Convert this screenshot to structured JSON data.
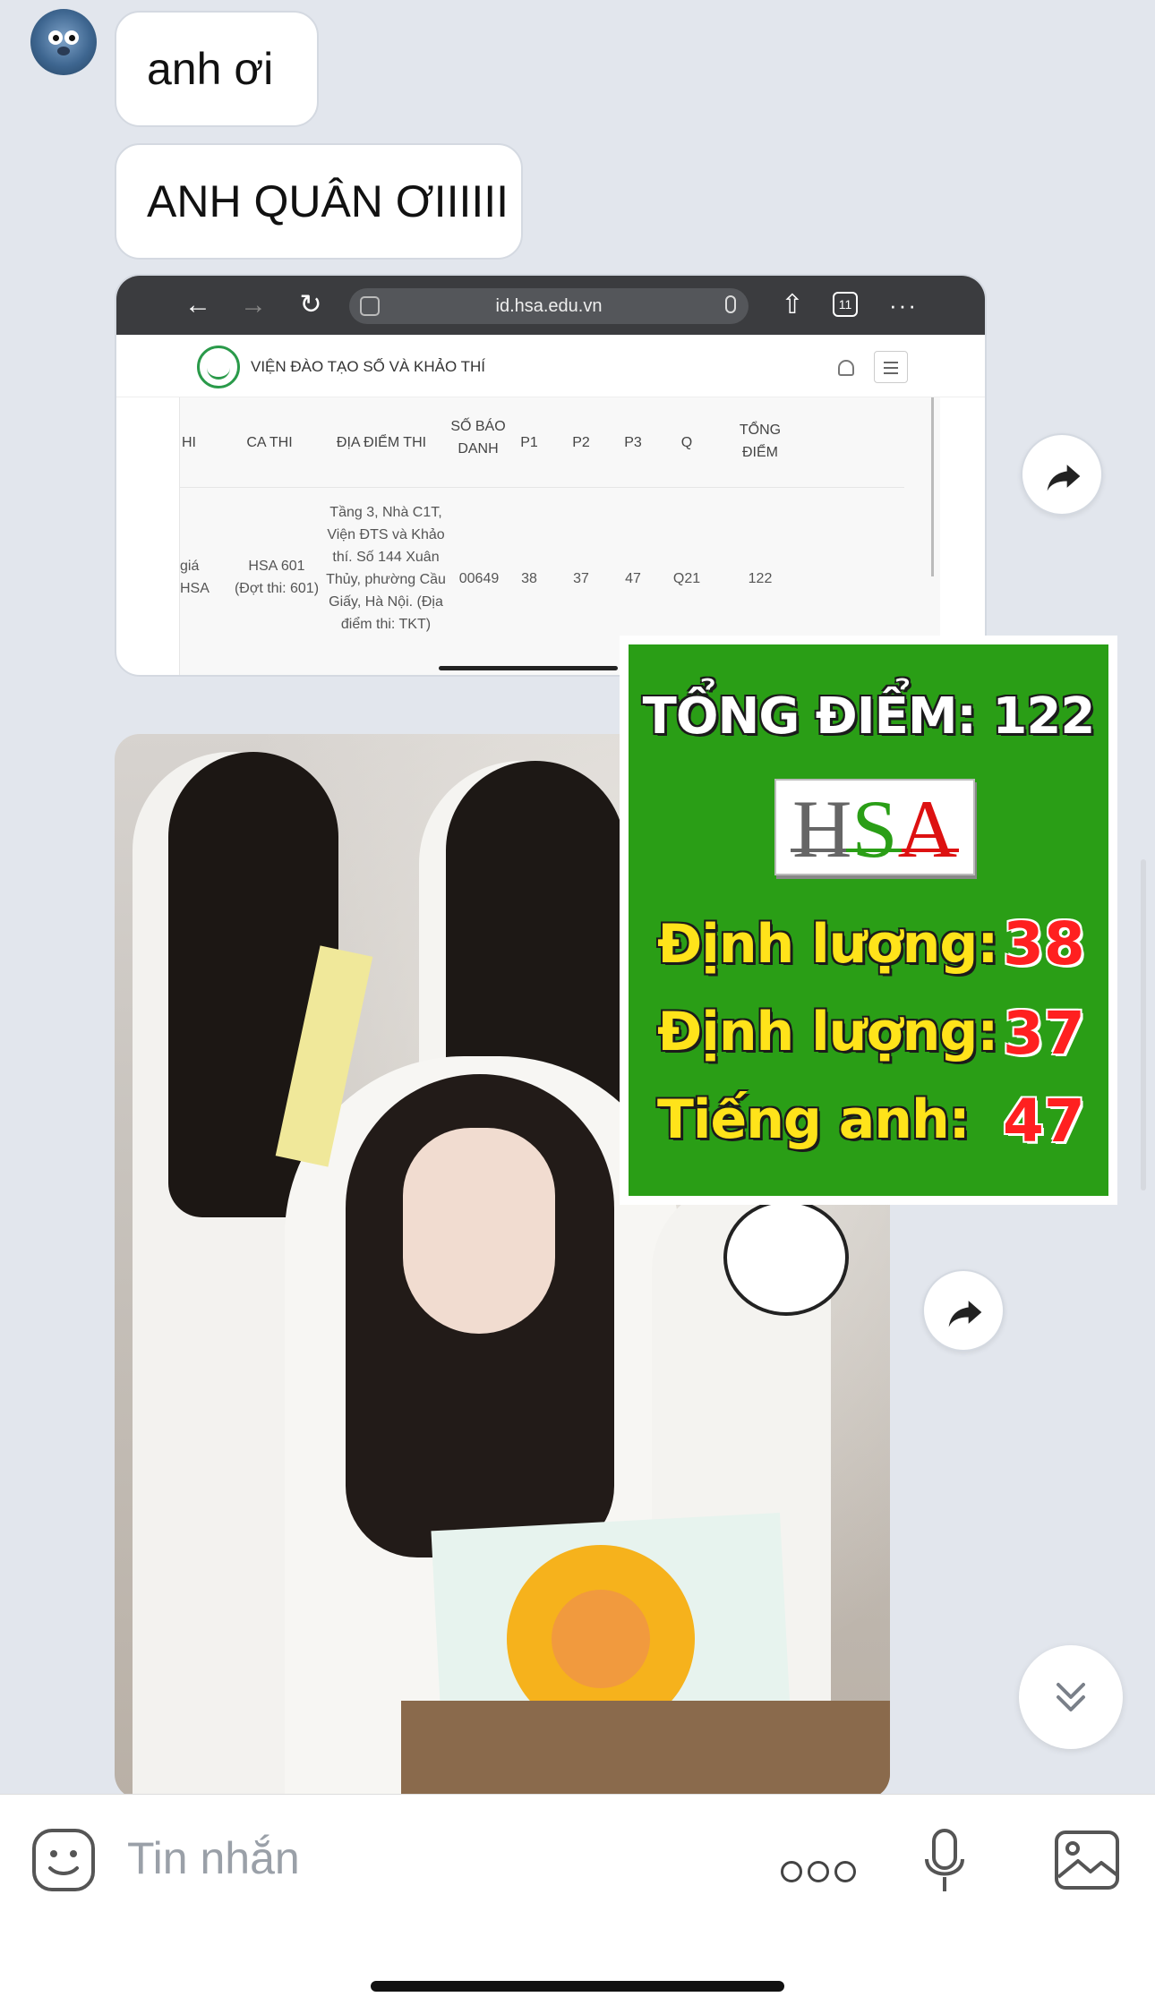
{
  "messages": [
    {
      "text": "anh ơi"
    },
    {
      "text": "ANH QUÂN ƠIIIIII"
    }
  ],
  "browser": {
    "url": "id.hsa.edu.vn",
    "tab_count": "11",
    "site_title": "VIỆN ĐÀO TẠO SỐ VÀ KHẢO THÍ",
    "headers": [
      "HI",
      "CA THI",
      "ĐỊA ĐIỂM THI",
      "SỐ BÁO DANH",
      "P1",
      "P2",
      "P3",
      "Q",
      "TỔNG ĐIỂM"
    ],
    "row": {
      "col0": "giá HSA",
      "ca_thi": "HSA 601 (Đợt thi: 601)",
      "dia_diem": "Tầng 3, Nhà C1T, Viện ĐTS và Khảo thí. Số 144 Xuân Thủy, phường Cầu Giấy, Hà Nội. (Địa điểm thi: TKT)",
      "so_bao_danh": "00649",
      "p1": "38",
      "p2": "37",
      "p3": "47",
      "q": "Q21",
      "tong_diem": "122"
    }
  },
  "overlay": {
    "title": "TỔNG ĐIỂM: 122",
    "logo_text": "HSA",
    "rows": [
      {
        "label": "Định lượng:",
        "value": "38"
      },
      {
        "label": "Định lượng:",
        "value": "37"
      },
      {
        "label": "Tiếng anh:",
        "value": "47"
      }
    ]
  },
  "input": {
    "placeholder": "Tin nhắn"
  },
  "icons": [
    "avatar",
    "back-icon",
    "forward-icon",
    "reload-icon",
    "mic-icon",
    "share-icon",
    "tabs-icon",
    "more-icon",
    "bell-icon",
    "menu-icon",
    "forward-share-icon",
    "chevron-double-down-icon",
    "sticker-icon",
    "more-dots-icon",
    "voice-icon",
    "image-icon"
  ],
  "colors": {
    "background": "#e2e6ed",
    "overlay_green": "#2a9e16",
    "overlay_yellow": "#ffe31a",
    "overlay_red": "#ff2020"
  }
}
